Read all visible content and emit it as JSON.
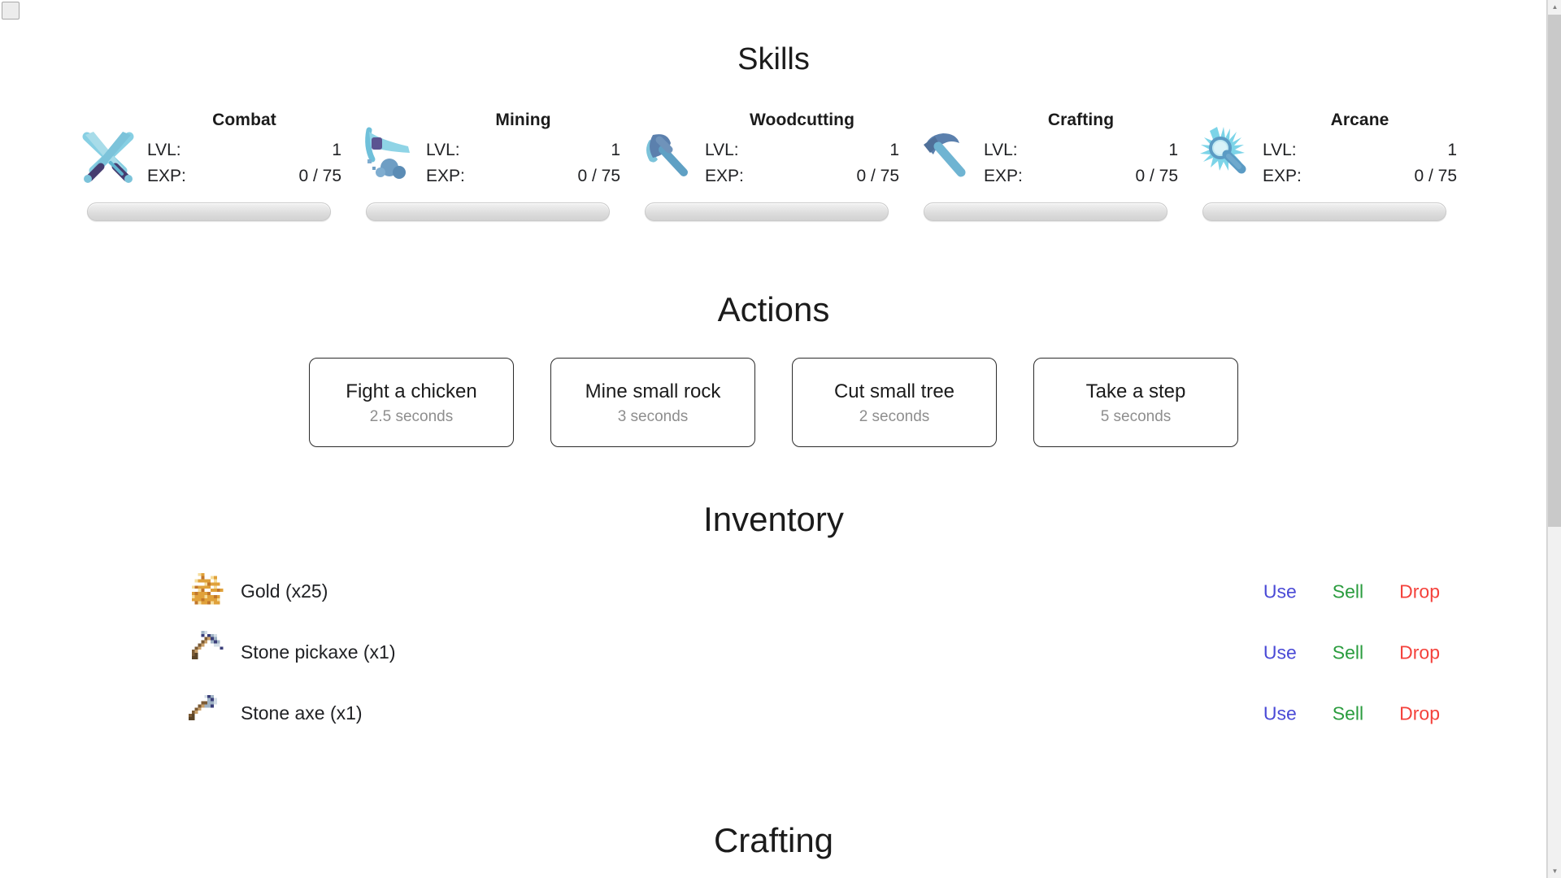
{
  "sections": {
    "skills_title": "Skills",
    "actions_title": "Actions",
    "inventory_title": "Inventory",
    "crafting_title": "Crafting"
  },
  "labels": {
    "lvl": "LVL:",
    "exp": "EXP:"
  },
  "skills": [
    {
      "name": "Combat",
      "icon": "crossed-swords-icon",
      "lvl": "1",
      "exp": "0 / 75",
      "progress_pct": 0
    },
    {
      "name": "Mining",
      "icon": "pickaxe-icon",
      "lvl": "1",
      "exp": "0 / 75",
      "progress_pct": 0
    },
    {
      "name": "Woodcutting",
      "icon": "axe-icon",
      "lvl": "1",
      "exp": "0 / 75",
      "progress_pct": 0
    },
    {
      "name": "Crafting",
      "icon": "hammer-icon",
      "lvl": "1",
      "exp": "0 / 75",
      "progress_pct": 0
    },
    {
      "name": "Arcane",
      "icon": "magic-wand-icon",
      "lvl": "1",
      "exp": "0 / 75",
      "progress_pct": 0
    }
  ],
  "actions": [
    {
      "label": "Fight a chicken",
      "duration": "2.5 seconds"
    },
    {
      "label": "Mine small rock",
      "duration": "3 seconds"
    },
    {
      "label": "Cut small tree",
      "duration": "2 seconds"
    },
    {
      "label": "Take a step",
      "duration": "5 seconds"
    }
  ],
  "inventory": {
    "action_labels": {
      "use": "Use",
      "sell": "Sell",
      "drop": "Drop"
    },
    "items": [
      {
        "name": "Gold (x25)",
        "icon": "gold-coins-icon"
      },
      {
        "name": "Stone pickaxe (x1)",
        "icon": "stone-pickaxe-icon"
      },
      {
        "name": "Stone axe (x1)",
        "icon": "stone-axe-icon"
      }
    ]
  },
  "colors": {
    "use": "#4a4ad6",
    "sell": "#2a9c3e",
    "drop": "#f4423c",
    "icon_blue_light": "#87cfe3",
    "icon_blue_mid": "#5b9bc4",
    "icon_purple": "#463d70"
  },
  "scrollbar": {
    "up_arrow": "▲",
    "down_arrow": "▼"
  }
}
